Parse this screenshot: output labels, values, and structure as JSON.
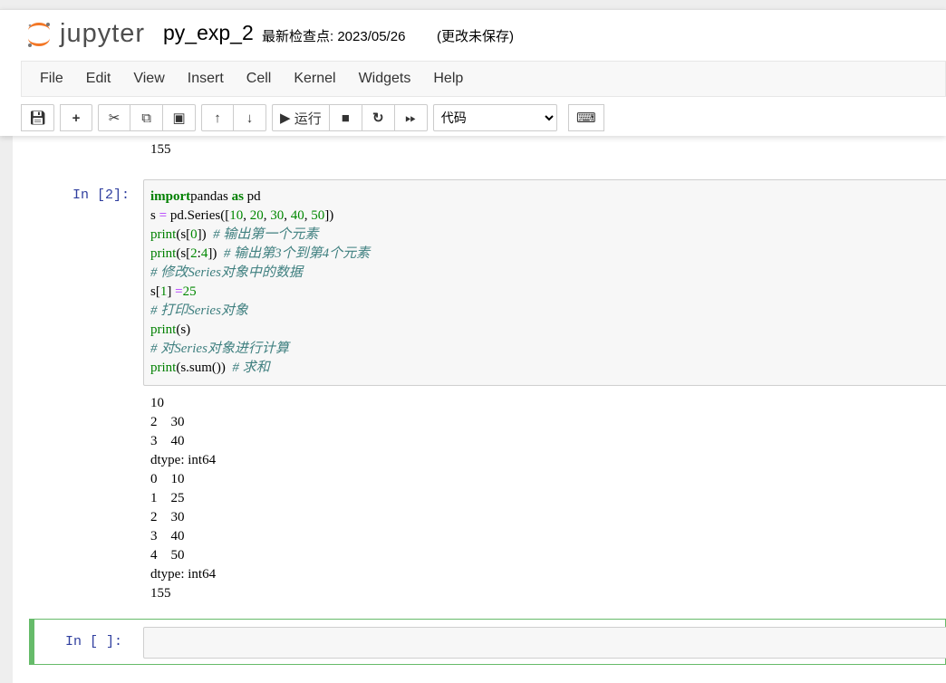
{
  "header": {
    "logo_text": "jupyter",
    "notebook_name": "py_exp_2",
    "checkpoint": "最新检查点: 2023/05/26",
    "unsaved": "(更改未保存)"
  },
  "menu": [
    "File",
    "Edit",
    "View",
    "Insert",
    "Cell",
    "Kernel",
    "Widgets",
    "Help"
  ],
  "toolbar": {
    "run_label": "运行",
    "cell_type": "代码"
  },
  "prev_output": "155",
  "cell2": {
    "prompt": "In  [2]:",
    "code": [
      [
        [
          "k",
          "import"
        ],
        [
          "",
          "pandas "
        ],
        [
          "k",
          "as"
        ],
        [
          "",
          " pd"
        ]
      ],
      [
        [
          "",
          "s "
        ],
        [
          "o",
          "="
        ],
        [
          "",
          " pd.Series(["
        ],
        [
          "n",
          "10"
        ],
        [
          "",
          ", "
        ],
        [
          "n",
          "20"
        ],
        [
          "",
          ", "
        ],
        [
          "n",
          "30"
        ],
        [
          "",
          ", "
        ],
        [
          "n",
          "40"
        ],
        [
          "",
          ", "
        ],
        [
          "n",
          "50"
        ],
        [
          "",
          "])"
        ]
      ],
      [
        [
          "b",
          "print"
        ],
        [
          "",
          "(s["
        ],
        [
          "n",
          "0"
        ],
        [
          "",
          "])  "
        ],
        [
          "c",
          "# 输出第一个元素"
        ]
      ],
      [
        [
          "b",
          "print"
        ],
        [
          "",
          "(s["
        ],
        [
          "n",
          "2"
        ],
        [
          "",
          ":"
        ],
        [
          "n",
          "4"
        ],
        [
          "",
          "])  "
        ],
        [
          "c",
          "# 输出第3个到第4个元素"
        ]
      ],
      [
        [
          "c",
          "# 修改Series对象中的数据"
        ]
      ],
      [
        [
          "",
          "s["
        ],
        [
          "n",
          "1"
        ],
        [
          "",
          "] "
        ],
        [
          "o",
          "="
        ],
        [
          "",
          "",
          " "
        ],
        [
          "n",
          "25"
        ]
      ],
      [
        [
          "c",
          "# 打印Series对象"
        ]
      ],
      [
        [
          "b",
          "print"
        ],
        [
          "",
          "(s)"
        ]
      ],
      [
        [
          "c",
          "# 对Series对象进行计算"
        ]
      ],
      [
        [
          "b",
          "print"
        ],
        [
          "",
          "(s.sum())  "
        ],
        [
          "c",
          "# 求和"
        ]
      ]
    ],
    "output": [
      "10",
      "2    30",
      "3    40",
      "dtype: int64",
      "0    10",
      "1    25",
      "2    30",
      "3    40",
      "4    50",
      "dtype: int64",
      "155"
    ]
  },
  "cell3": {
    "prompt": "In  [ ]:"
  }
}
